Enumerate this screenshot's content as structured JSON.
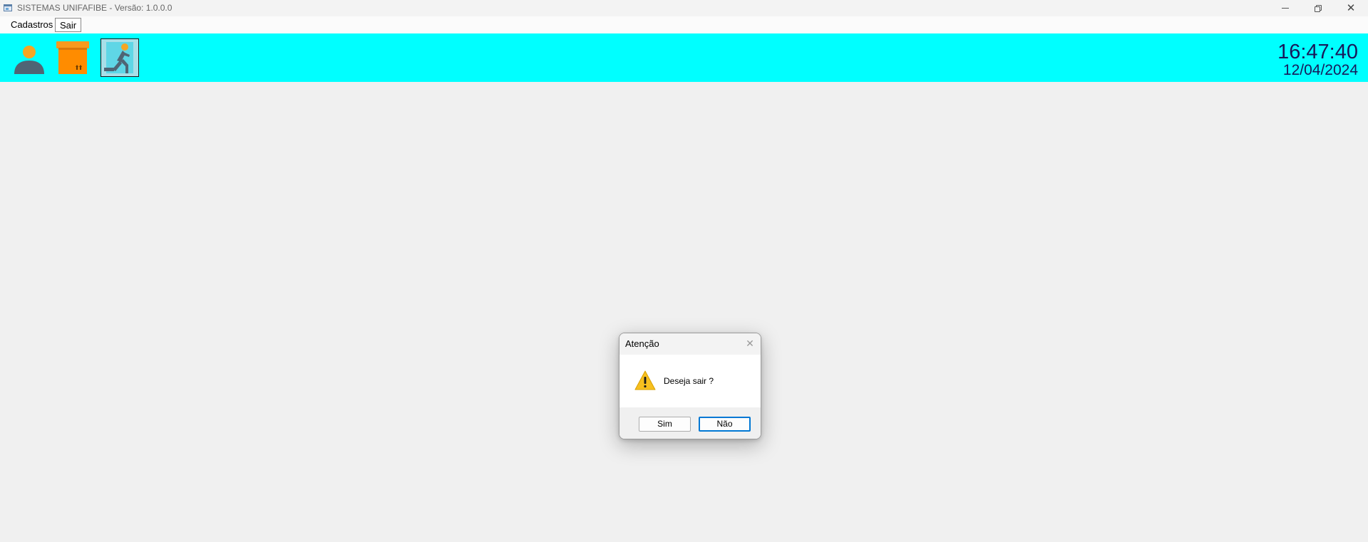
{
  "window": {
    "title": "SISTEMAS UNIFAFIBE - Versão: 1.0.0.0",
    "controls": {
      "minimize_icon": "minimize-icon",
      "maximize_icon": "restore-icon",
      "close_glyph": "✕"
    }
  },
  "menu": {
    "items": [
      {
        "label": "Cadastros"
      },
      {
        "label": "Sair"
      }
    ]
  },
  "toolbar": {
    "background_color": "#00ffff",
    "buttons": [
      {
        "icon": "user-icon"
      },
      {
        "icon": "package-box-icon"
      },
      {
        "icon": "exit-running-person-icon"
      }
    ],
    "clock": {
      "time": "16:47:40",
      "date": "12/04/2024"
    }
  },
  "dialog": {
    "title": "Atenção",
    "close_glyph": "✕",
    "icon": "warning-icon",
    "message": "Deseja sair ?",
    "buttons": {
      "yes_label": "Sim",
      "no_label": "Não"
    },
    "focused_button": "Não"
  }
}
